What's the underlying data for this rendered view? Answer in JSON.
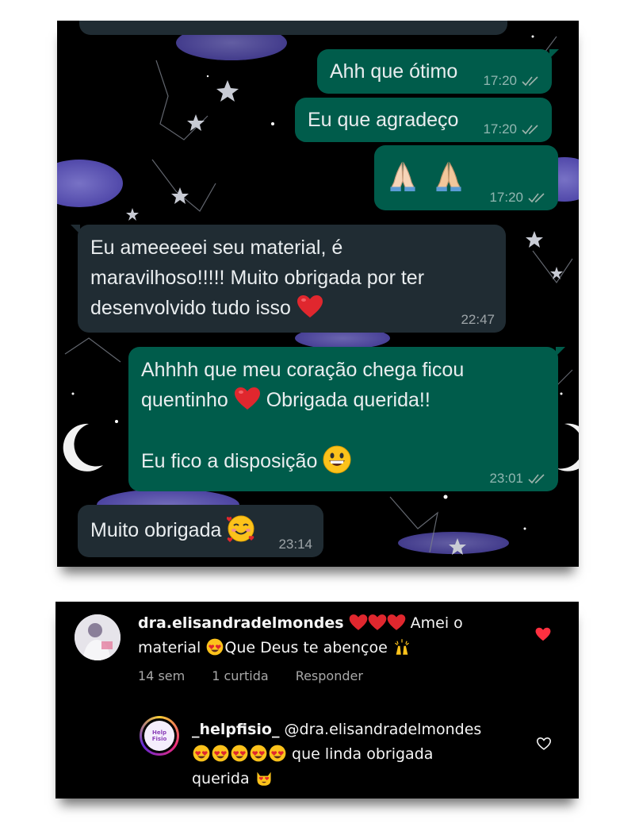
{
  "chat": {
    "messages": [
      {
        "direction": "out",
        "text": "Ahh que ótimo",
        "time": "17:20"
      },
      {
        "direction": "out",
        "text": "Eu que agradeço",
        "time": "17:20"
      },
      {
        "direction": "out",
        "text": "",
        "emojis": [
          "folded-hands",
          "folded-hands"
        ],
        "time": "17:20"
      },
      {
        "direction": "in",
        "line1": "Eu ameeeeei seu material, é",
        "line2": "maravilhoso!!!!! Muito obrigada por ter",
        "line3": "desenvolvido tudo isso",
        "emoji": "red-heart",
        "time": "22:47"
      },
      {
        "direction": "out",
        "line1": "Ahhhh que meu coração chega ficou",
        "line2a": "quentinho",
        "emoji": "red-heart",
        "line2b": "Obrigada querida!!",
        "line3": "Eu fico a disposição",
        "emoji2": "grinning-face",
        "time": "23:01"
      },
      {
        "direction": "in",
        "text": "Muito obrigada",
        "emoji": "smiling-face-with-hearts",
        "time": "23:14"
      }
    ],
    "colors": {
      "outgoing": "#005c4b",
      "incoming": "#202c33",
      "ticks": "#9fb4ad"
    }
  },
  "instagram": {
    "comment": {
      "username": "dra.elisandradelmondes",
      "text_a": "Amei o",
      "text_b": "material",
      "text_c": "Que Deus te abençoe",
      "emojis": [
        "red-heart",
        "red-heart",
        "red-heart",
        "heart-eyes",
        "raising-hands"
      ],
      "age": "14 sem",
      "likes": "1 curtida",
      "reply": "Responder",
      "liked": true
    },
    "reply": {
      "username": "_helpfisio_",
      "mention": "@dra.elisandradelmondes",
      "text_a": "que linda obrigada",
      "text_b": "querida",
      "emojis": [
        "heart-eyes",
        "heart-eyes",
        "heart-eyes",
        "heart-eyes",
        "heart-eyes",
        "heart-eyes-cat"
      ],
      "avatar_text": "Help Fisio",
      "liked": false
    },
    "colors": {
      "like_red": "#ff3040",
      "meta_gray": "#a8a8a8"
    }
  }
}
